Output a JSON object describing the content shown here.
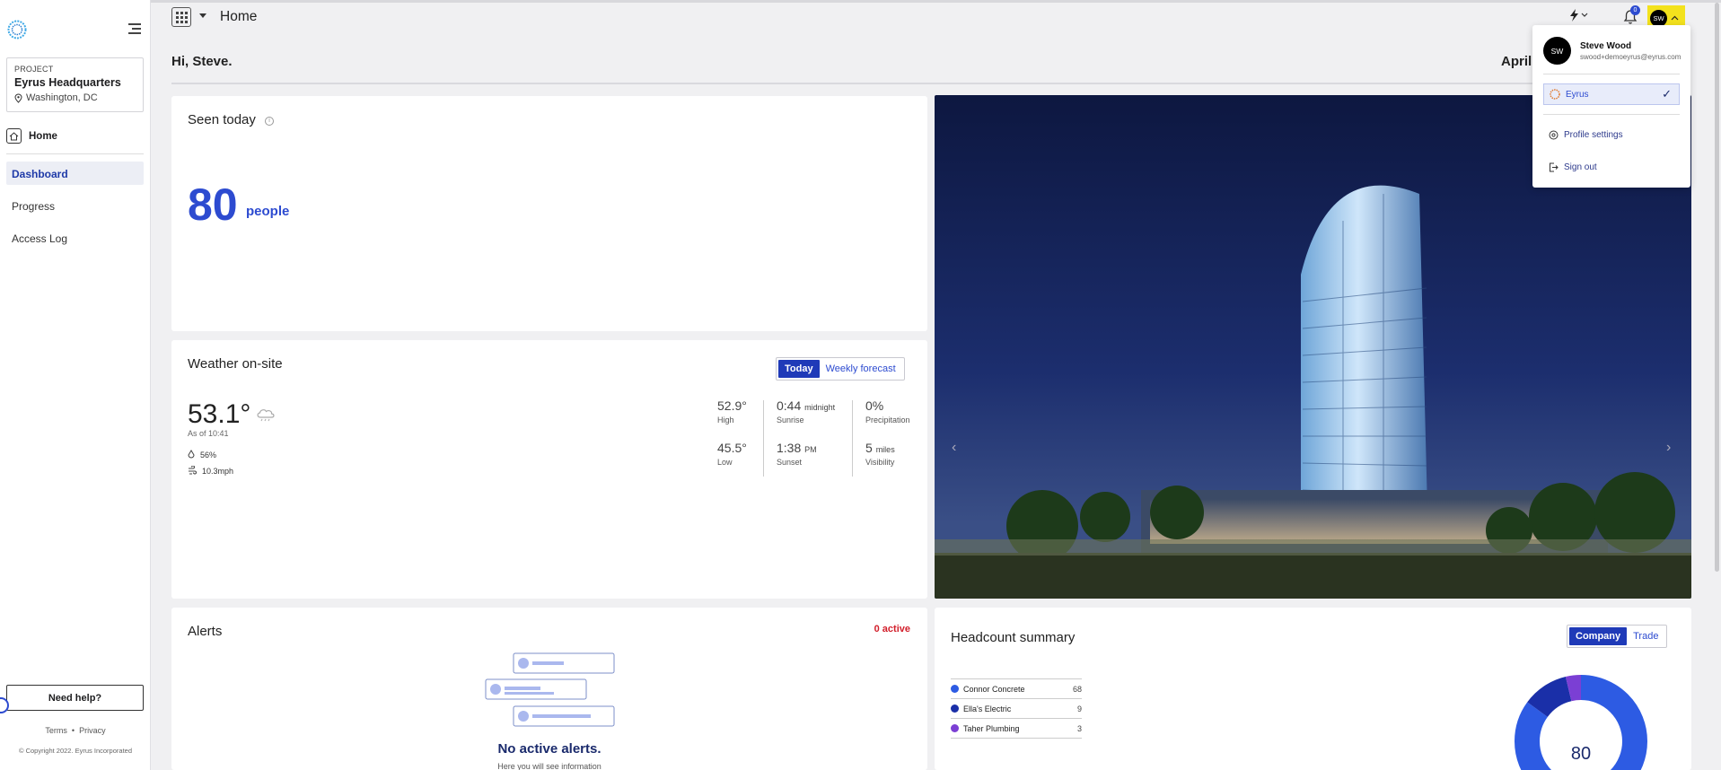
{
  "topbar": {
    "page_title": "Home",
    "notification_count": "0",
    "user_initials": "SW"
  },
  "sidebar": {
    "project_label": "PROJECT",
    "project_name": "Eyrus Headquarters",
    "project_location": "Washington, DC",
    "home_label": "Home",
    "nav": [
      {
        "label": "Dashboard"
      },
      {
        "label": "Progress"
      },
      {
        "label": "Access Log"
      }
    ],
    "need_help": "Need help?",
    "terms": "Terms",
    "privacy": "Privacy",
    "copyright": "© Copyright 2022. Eyrus Incorporated"
  },
  "greeting": "Hi, Steve.",
  "date": "April",
  "seen_today": {
    "title": "Seen today",
    "count": "80",
    "unit": "people"
  },
  "weather": {
    "title": "Weather on-site",
    "toggle": {
      "today": "Today",
      "weekly": "Weekly forecast"
    },
    "temperature": "53.1°",
    "as_of": "As of 10:41",
    "humidity": "56%",
    "wind": "10.3mph",
    "high": "52.9°",
    "high_label": "High",
    "low": "45.5°",
    "low_label": "Low",
    "sunrise": "0:44",
    "sunrise_suffix": "midnight",
    "sunrise_label": "Sunrise",
    "sunset": "1:38",
    "sunset_suffix": "PM",
    "sunset_label": "Sunset",
    "precipitation": "0%",
    "precipitation_label": "Precipitation",
    "visibility": "5",
    "visibility_suffix": "miles",
    "visibility_label": "Visibility"
  },
  "alerts": {
    "title": "Alerts",
    "active_count": "0 active",
    "empty_title": "No active alerts.",
    "empty_sub": "Here you will see information"
  },
  "headcount": {
    "title": "Headcount summary",
    "toggle": {
      "company": "Company",
      "trade": "Trade"
    },
    "rows": [
      {
        "name": "Connor Concrete",
        "count": "68",
        "color": "#2d5be3"
      },
      {
        "name": "Ella's Electric",
        "count": "9",
        "color": "#1a2fa8"
      },
      {
        "name": "Taher Plumbing",
        "count": "3",
        "color": "#7b3fd4"
      }
    ],
    "total": "80"
  },
  "user_menu": {
    "initials": "SW",
    "name": "Steve Wood",
    "email": "swood+demoeyrus@eyrus.com",
    "org": "Eyrus",
    "profile_settings": "Profile settings",
    "sign_out": "Sign out"
  },
  "colors": {
    "accent": "#2d4bd0",
    "alert_red": "#d21f2b",
    "user_badge": "#f3e21d"
  }
}
